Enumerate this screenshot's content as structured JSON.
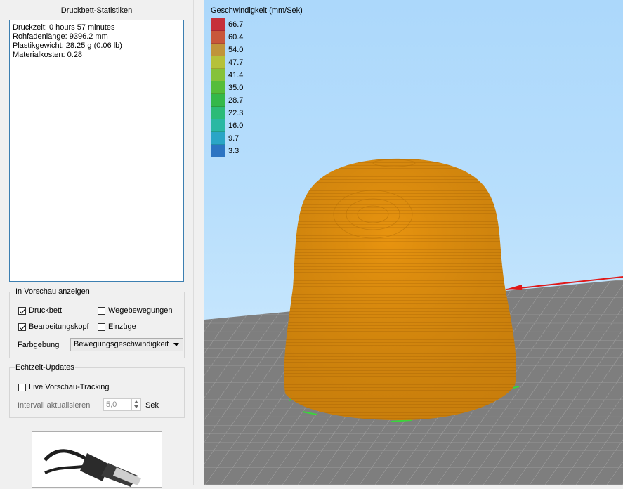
{
  "panel": {
    "title": "Druckbett-Statistiken",
    "stats": [
      "Druckzeit: 0 hours 57 minutes",
      "Rohfadenlänge: 9396.2 mm",
      "Plastikgewicht: 28.25 g (0.06 lb)",
      "Materialkosten: 0.28"
    ]
  },
  "preview": {
    "label": "In Vorschau anzeigen",
    "checkboxes": [
      {
        "label": "Druckbett",
        "checked": true
      },
      {
        "label": "Wegebewegungen",
        "checked": false
      },
      {
        "label": "Bearbeitungskopf",
        "checked": true
      },
      {
        "label": "Einzüge",
        "checked": false
      }
    ],
    "color_label": "Farbgebung",
    "color_value": "Bewegungsgeschwindigkeit"
  },
  "realtime": {
    "label": "Echtzeit-Updates",
    "live_tracking_label": "Live Vorschau-Tracking",
    "live_tracking_checked": false,
    "interval_label": "Intervall aktualisieren",
    "interval_value": "5,0",
    "interval_unit": "Sek"
  },
  "legend": {
    "title": "Geschwindigkeit (mm/Sek)",
    "entries": [
      {
        "value": "66.7",
        "color": "#c6303a"
      },
      {
        "value": "60.4",
        "color": "#c8573b"
      },
      {
        "value": "54.0",
        "color": "#c0943a"
      },
      {
        "value": "47.7",
        "color": "#b5c13a"
      },
      {
        "value": "41.4",
        "color": "#85c23a"
      },
      {
        "value": "35.0",
        "color": "#55bd3a"
      },
      {
        "value": "28.7",
        "color": "#34b84a"
      },
      {
        "value": "22.3",
        "color": "#2cbb78"
      },
      {
        "value": "16.0",
        "color": "#2ab8a3"
      },
      {
        "value": "9.7",
        "color": "#2aa5c6"
      },
      {
        "value": "3.3",
        "color": "#2c74c2"
      }
    ]
  },
  "model_color": "#e8940f",
  "bed_color": "#7e7e7e"
}
